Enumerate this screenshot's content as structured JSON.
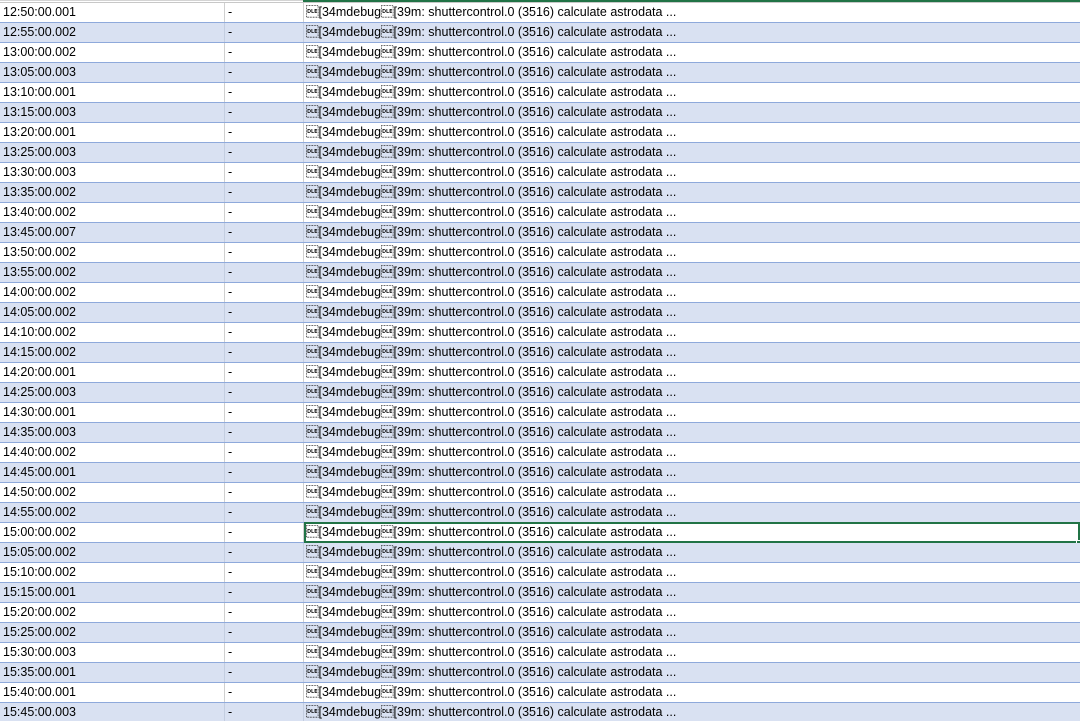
{
  "sheet": {
    "selected_row_index": 26,
    "colors": {
      "band": "#d9e1f2",
      "row_border": "#8ea9db",
      "selection": "#217346"
    },
    "rows": [
      {
        "time": "12:50:00.001",
        "level": "-",
        "message": "\u0010[34mdebug\u0010[39m: shuttercontrol.0 (3516) calculate astrodata ..."
      },
      {
        "time": "12:55:00.002",
        "level": "-",
        "message": "\u0010[34mdebug\u0010[39m: shuttercontrol.0 (3516) calculate astrodata ..."
      },
      {
        "time": "13:00:00.002",
        "level": "-",
        "message": "\u0010[34mdebug\u0010[39m: shuttercontrol.0 (3516) calculate astrodata ..."
      },
      {
        "time": "13:05:00.003",
        "level": "-",
        "message": "\u0010[34mdebug\u0010[39m: shuttercontrol.0 (3516) calculate astrodata ..."
      },
      {
        "time": "13:10:00.001",
        "level": "-",
        "message": "\u0010[34mdebug\u0010[39m: shuttercontrol.0 (3516) calculate astrodata ..."
      },
      {
        "time": "13:15:00.003",
        "level": "-",
        "message": "\u0010[34mdebug\u0010[39m: shuttercontrol.0 (3516) calculate astrodata ..."
      },
      {
        "time": "13:20:00.001",
        "level": "-",
        "message": "\u0010[34mdebug\u0010[39m: shuttercontrol.0 (3516) calculate astrodata ..."
      },
      {
        "time": "13:25:00.003",
        "level": "-",
        "message": "\u0010[34mdebug\u0010[39m: shuttercontrol.0 (3516) calculate astrodata ..."
      },
      {
        "time": "13:30:00.003",
        "level": "-",
        "message": "\u0010[34mdebug\u0010[39m: shuttercontrol.0 (3516) calculate astrodata ..."
      },
      {
        "time": "13:35:00.002",
        "level": "-",
        "message": "\u0010[34mdebug\u0010[39m: shuttercontrol.0 (3516) calculate astrodata ..."
      },
      {
        "time": "13:40:00.002",
        "level": "-",
        "message": "\u0010[34mdebug\u0010[39m: shuttercontrol.0 (3516) calculate astrodata ..."
      },
      {
        "time": "13:45:00.007",
        "level": "-",
        "message": "\u0010[34mdebug\u0010[39m: shuttercontrol.0 (3516) calculate astrodata ..."
      },
      {
        "time": "13:50:00.002",
        "level": "-",
        "message": "\u0010[34mdebug\u0010[39m: shuttercontrol.0 (3516) calculate astrodata ..."
      },
      {
        "time": "13:55:00.002",
        "level": "-",
        "message": "\u0010[34mdebug\u0010[39m: shuttercontrol.0 (3516) calculate astrodata ..."
      },
      {
        "time": "14:00:00.002",
        "level": "-",
        "message": "\u0010[34mdebug\u0010[39m: shuttercontrol.0 (3516) calculate astrodata ..."
      },
      {
        "time": "14:05:00.002",
        "level": "-",
        "message": "\u0010[34mdebug\u0010[39m: shuttercontrol.0 (3516) calculate astrodata ..."
      },
      {
        "time": "14:10:00.002",
        "level": "-",
        "message": "\u0010[34mdebug\u0010[39m: shuttercontrol.0 (3516) calculate astrodata ..."
      },
      {
        "time": "14:15:00.002",
        "level": "-",
        "message": "\u0010[34mdebug\u0010[39m: shuttercontrol.0 (3516) calculate astrodata ..."
      },
      {
        "time": "14:20:00.001",
        "level": "-",
        "message": "\u0010[34mdebug\u0010[39m: shuttercontrol.0 (3516) calculate astrodata ..."
      },
      {
        "time": "14:25:00.003",
        "level": "-",
        "message": "\u0010[34mdebug\u0010[39m: shuttercontrol.0 (3516) calculate astrodata ..."
      },
      {
        "time": "14:30:00.001",
        "level": "-",
        "message": "\u0010[34mdebug\u0010[39m: shuttercontrol.0 (3516) calculate astrodata ..."
      },
      {
        "time": "14:35:00.003",
        "level": "-",
        "message": "\u0010[34mdebug\u0010[39m: shuttercontrol.0 (3516) calculate astrodata ..."
      },
      {
        "time": "14:40:00.002",
        "level": "-",
        "message": "\u0010[34mdebug\u0010[39m: shuttercontrol.0 (3516) calculate astrodata ..."
      },
      {
        "time": "14:45:00.001",
        "level": "-",
        "message": "\u0010[34mdebug\u0010[39m: shuttercontrol.0 (3516) calculate astrodata ..."
      },
      {
        "time": "14:50:00.002",
        "level": "-",
        "message": "\u0010[34mdebug\u0010[39m: shuttercontrol.0 (3516) calculate astrodata ..."
      },
      {
        "time": "14:55:00.002",
        "level": "-",
        "message": "\u0010[34mdebug\u0010[39m: shuttercontrol.0 (3516) calculate astrodata ..."
      },
      {
        "time": "15:00:00.002",
        "level": "-",
        "message": "\u0010[34mdebug\u0010[39m: shuttercontrol.0 (3516) calculate astrodata ..."
      },
      {
        "time": "15:05:00.002",
        "level": "-",
        "message": "\u0010[34mdebug\u0010[39m: shuttercontrol.0 (3516) calculate astrodata ..."
      },
      {
        "time": "15:10:00.002",
        "level": "-",
        "message": "\u0010[34mdebug\u0010[39m: shuttercontrol.0 (3516) calculate astrodata ..."
      },
      {
        "time": "15:15:00.001",
        "level": "-",
        "message": "\u0010[34mdebug\u0010[39m: shuttercontrol.0 (3516) calculate astrodata ..."
      },
      {
        "time": "15:20:00.002",
        "level": "-",
        "message": "\u0010[34mdebug\u0010[39m: shuttercontrol.0 (3516) calculate astrodata ..."
      },
      {
        "time": "15:25:00.002",
        "level": "-",
        "message": "\u0010[34mdebug\u0010[39m: shuttercontrol.0 (3516) calculate astrodata ..."
      },
      {
        "time": "15:30:00.003",
        "level": "-",
        "message": "\u0010[34mdebug\u0010[39m: shuttercontrol.0 (3516) calculate astrodata ..."
      },
      {
        "time": "15:35:00.001",
        "level": "-",
        "message": "\u0010[34mdebug\u0010[39m: shuttercontrol.0 (3516) calculate astrodata ..."
      },
      {
        "time": "15:40:00.001",
        "level": "-",
        "message": "\u0010[34mdebug\u0010[39m: shuttercontrol.0 (3516) calculate astrodata ..."
      },
      {
        "time": "15:45:00.003",
        "level": "-",
        "message": "\u0010[34mdebug\u0010[39m: shuttercontrol.0 (3516) calculate astrodata ..."
      }
    ]
  }
}
